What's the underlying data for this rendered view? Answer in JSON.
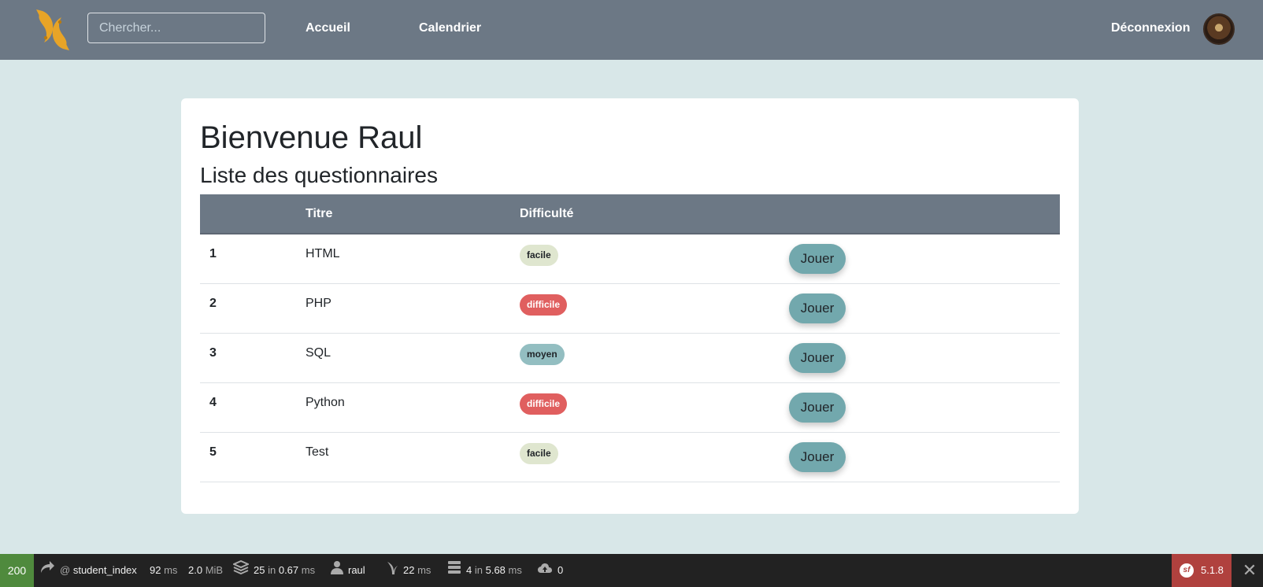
{
  "navbar": {
    "search_placeholder": "Chercher...",
    "links": [
      "Accueil",
      "Calendrier"
    ],
    "logout_label": "Déconnexion",
    "logo_icon": "koi-fish-icon",
    "avatar_icon": "user-avatar"
  },
  "main": {
    "welcome": "Bienvenue Raul",
    "subtitle": "Liste des questionnaires",
    "table": {
      "headers": [
        "",
        "Titre",
        "Difficulté",
        ""
      ],
      "rows": [
        {
          "id": "1",
          "title": "HTML",
          "difficulty": "facile",
          "action": "Jouer"
        },
        {
          "id": "2",
          "title": "PHP",
          "difficulty": "difficile",
          "action": "Jouer"
        },
        {
          "id": "3",
          "title": "SQL",
          "difficulty": "moyen",
          "action": "Jouer"
        },
        {
          "id": "4",
          "title": "Python",
          "difficulty": "difficile",
          "action": "Jouer"
        },
        {
          "id": "5",
          "title": "Test",
          "difficulty": "facile",
          "action": "Jouer"
        }
      ]
    },
    "difficulty_colors": {
      "facile": "#dfe6cf",
      "difficile": "#e05f5f",
      "moyen": "#93bec1"
    }
  },
  "debug_toolbar": {
    "status_code": "200",
    "route_prefix": "@",
    "route": "student_index",
    "time_value": "92",
    "time_unit": "ms",
    "memory_value": "2.0",
    "memory_unit": "MiB",
    "templates_count": "25",
    "templates_in": "in",
    "templates_time": "0.67",
    "templates_unit": "ms",
    "user": "raul",
    "twig_time": "22",
    "twig_unit": "ms",
    "db_queries": "4",
    "db_in": "in",
    "db_time": "5.68",
    "db_unit": "ms",
    "cache_count": "0",
    "symfony_version": "5.1.8",
    "status_color": "#4f8a3d",
    "symfony_color": "#b0413e"
  }
}
